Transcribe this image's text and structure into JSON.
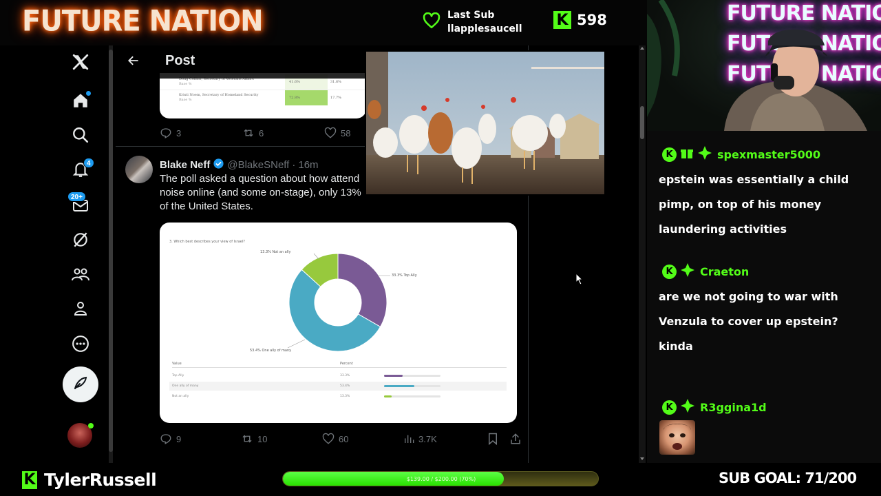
{
  "overlay": {
    "brand_title": "FUTURE NATION",
    "last_sub": {
      "label": "Last Sub",
      "name": "llapplesaucell"
    },
    "follower_count": "598",
    "streamer_name": "TylerRussell",
    "sub_goal": {
      "text": "$139.00 / $200.00 (70%)",
      "progress_fraction": 0.7,
      "label": "SUB GOAL: 71/200"
    },
    "webcam_neon": [
      "FUTURE NATION",
      "FUTURE NATION",
      "FUTURE NATION"
    ],
    "colors": {
      "kick_green": "#53fc18",
      "x_blue": "#1d9bf0"
    }
  },
  "x_app": {
    "nav": {
      "icons": [
        "x-logo-icon",
        "home-icon",
        "search-icon",
        "notifications-icon",
        "messages-icon",
        "grok-icon",
        "communities-icon",
        "profile-icon",
        "more-icon",
        "compose-icon",
        "account-avatar"
      ],
      "notifications_badge": "4",
      "messages_badge": "20+"
    },
    "header": {
      "title": "Post"
    },
    "previous_table": {
      "rows": [
        {
          "name": "Doug Collins, Secretary of Veterans Affairs",
          "sub": "Base %",
          "c1": "41.6%",
          "c2": "31.6%"
        },
        {
          "name": "Kristi Noem, Secretary of Homeland Security",
          "sub": "Base %",
          "c1": "72.8%",
          "c2": "17.7%"
        }
      ]
    },
    "previous_actions": {
      "replies": "3",
      "reposts": "6",
      "likes": "58"
    },
    "post": {
      "author_name": "Blake Neff",
      "handle": "@BlakeSNeff",
      "time": "16m",
      "text_line1": "The poll asked a question about how attend",
      "text_line2": "noise online (and some on-stage), only 13%",
      "text_line3": "of the United States.",
      "actions": {
        "replies": "9",
        "reposts": "10",
        "likes": "60",
        "views": "3.7K"
      }
    },
    "chart": {
      "question": "3. Which best describes your view of Israel?",
      "labels": {
        "not_ally": "13.3% Not an ally",
        "top_ally": "33.3% Top Ally",
        "one_of_many": "53.4% One ally of many"
      },
      "table_headers": {
        "value": "Value",
        "percent": "Percent"
      },
      "rows": [
        {
          "value": "Top Ally",
          "percent": "33.3%"
        },
        {
          "value": "One ally of many",
          "percent": "53.4%"
        },
        {
          "value": "Not an ally",
          "percent": "13.3%"
        }
      ]
    }
  },
  "chart_data": {
    "type": "pie",
    "categories": [
      "Top Ally",
      "One ally of many",
      "Not an ally"
    ],
    "values": [
      33.3,
      53.4,
      13.3
    ],
    "colors": [
      "#7a5a95",
      "#4aaac4",
      "#97c93d"
    ],
    "title": "3. Which best describes your view of Israel?"
  },
  "chat": {
    "messages": [
      {
        "user": "spexmaster5000",
        "text": "epstein was essentially a child pimp, on top of his money laundering activities"
      },
      {
        "user": "Craeton",
        "text": "are we not going to war with Venzula to cover up epstein? kinda"
      },
      {
        "user": "R3ggina1d",
        "text": ""
      }
    ]
  }
}
